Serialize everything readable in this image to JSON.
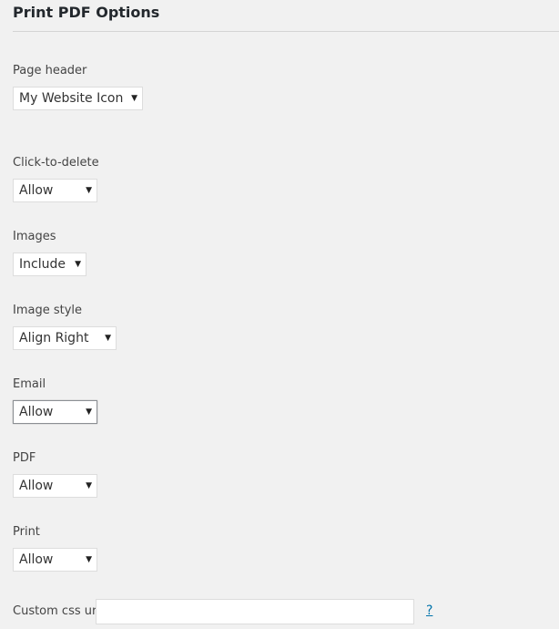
{
  "header": {
    "title": "Print PDF Options"
  },
  "fields": {
    "page_header": {
      "label": "Page header",
      "value": "My Website Icon"
    },
    "click_to_delete": {
      "label": "Click-to-delete",
      "value": "Allow"
    },
    "images": {
      "label": "Images",
      "value": "Include"
    },
    "image_style": {
      "label": "Image style",
      "value": "Align Right"
    },
    "email": {
      "label": "Email",
      "value": "Allow"
    },
    "pdf": {
      "label": "PDF",
      "value": "Allow"
    },
    "print": {
      "label": "Print",
      "value": "Allow"
    },
    "custom_css_url": {
      "label": "Custom css url",
      "value": "",
      "help": "?"
    }
  },
  "icons": {
    "dropdown_arrow": "▼"
  },
  "colors": {
    "background": "#f1f1f1",
    "link": "#0073aa",
    "border": "#dddddd"
  }
}
